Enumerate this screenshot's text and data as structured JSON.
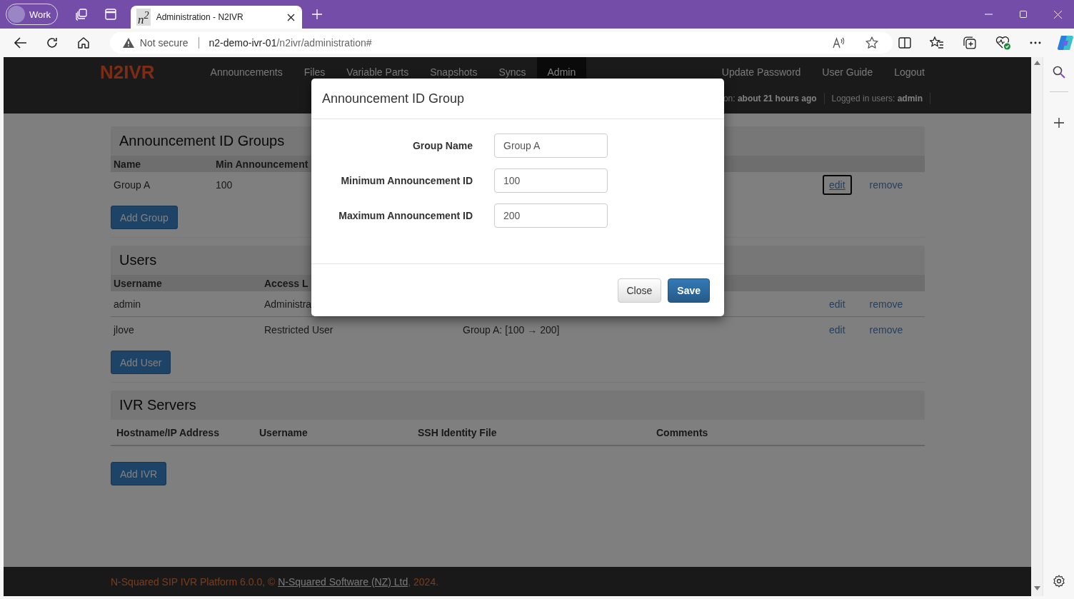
{
  "browser": {
    "profile": {
      "label": "Work"
    },
    "tabs": [
      {
        "favicon": "n$^{2}$",
        "title": "Administration - N2IVR",
        "selected": true
      }
    ],
    "address_bar": {
      "security": "Not secure",
      "host": "n2-demo-ivr-01",
      "path": "/n2ivr/administration#"
    }
  },
  "navbar": {
    "logo": "N2IVR",
    "items": [
      {
        "label": "Announcements",
        "selected": false
      },
      {
        "label": "Files",
        "selected": false
      },
      {
        "label": "Variable Parts",
        "selected": false
      },
      {
        "label": "Snapshots",
        "selected": false
      },
      {
        "label": "Syncs",
        "selected": false
      },
      {
        "label": "Admin",
        "selected": true
      }
    ],
    "links": [
      "Update Password",
      "User Guide",
      "Logout"
    ],
    "status": [
      "on: **about 21 hours ago**",
      "Logged in users: **admin**"
    ]
  },
  "sections": [
    {
      "title": "Announcement ID Groups",
      "columns": [
        "Name",
        "Min Announcement"
      ],
      "rows": [
        {
          "cells": [
            "Group A",
            "100"
          ],
          "actions": [
            {
              "label": "edit",
              "focused": true
            },
            {
              "label": "remove",
              "focused": false
            }
          ]
        }
      ],
      "button": "Add Group"
    },
    {
      "title": "Users",
      "columns": [
        "Username",
        "Access L"
      ],
      "rows": [
        {
          "cells": [
            "admin",
            "Administra"
          ],
          "actions": [
            {
              "label": "edit",
              "focused": false
            },
            {
              "label": "remove",
              "focused": false
            }
          ]
        },
        {
          "cells": [
            "jlove",
            "Restricted User",
            "Group A: [100 → 200]"
          ],
          "actions": [
            {
              "label": "edit",
              "focused": false
            },
            {
              "label": "remove",
              "focused": false
            }
          ]
        }
      ],
      "button": "Add User"
    },
    {
      "title": "IVR Servers",
      "columns": [
        "Hostname/IP Address",
        "Username",
        "SSH Identity File",
        "Comments"
      ],
      "button": "Add IVR"
    }
  ],
  "footer": {
    "text": "N-Squared SIP IVR Platform 6.0.0, © ",
    "link": "N-Squared Software (NZ) Ltd",
    "suffix": ", 2024."
  },
  "modal": {
    "title": "Announcement ID Group",
    "fields": [
      {
        "label": "Group Name",
        "value": "Group A"
      },
      {
        "label": "Minimum Announcement ID",
        "value": "100"
      },
      {
        "label": "Maximum Announcement ID",
        "value": "200"
      }
    ],
    "buttons": [
      {
        "label": "Close",
        "kind": "default"
      },
      {
        "label": "Save",
        "kind": "primary"
      }
    ]
  }
}
